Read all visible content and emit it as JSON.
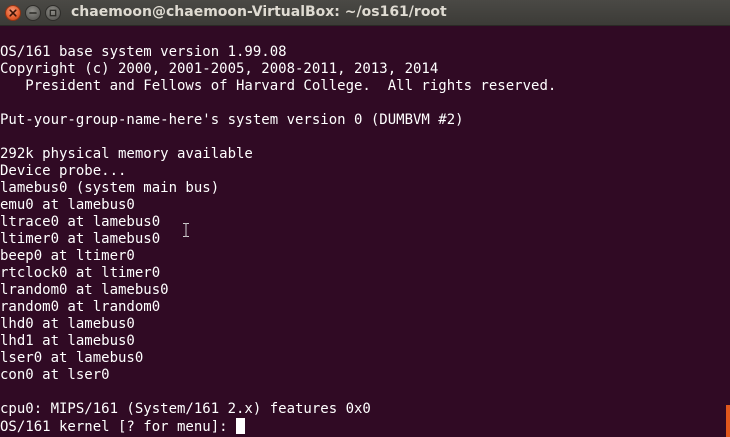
{
  "window": {
    "title": "chaemoon@chaemoon-VirtualBox: ~/os161/root",
    "buttons": [
      {
        "name": "close",
        "icon": "close-icon"
      },
      {
        "name": "minimize",
        "icon": "minimize-icon"
      },
      {
        "name": "maximize",
        "icon": "maximize-icon"
      }
    ]
  },
  "terminal": {
    "lines": [
      "OS/161 base system version 1.99.08",
      "Copyright (c) 2000, 2001-2005, 2008-2011, 2013, 2014",
      "   President and Fellows of Harvard College.  All rights reserved.",
      "",
      "Put-your-group-name-here's system version 0 (DUMBVM #2)",
      "",
      "292k physical memory available",
      "Device probe...",
      "lamebus0 (system main bus)",
      "emu0 at lamebus0",
      "ltrace0 at lamebus0",
      "ltimer0 at lamebus0",
      "beep0 at ltimer0",
      "rtclock0 at ltimer0",
      "lrandom0 at lamebus0",
      "random0 at lrandom0",
      "lhd0 at lamebus0",
      "lhd1 at lamebus0",
      "lser0 at lamebus0",
      "con0 at lser0",
      "",
      "cpu0: MIPS/161 (System/161 2.x) features 0x0"
    ],
    "prompt": "OS/161 kernel [? for menu]: "
  },
  "colors": {
    "background": "#300a24",
    "foreground": "#ffffff",
    "titlebar": "#3c3b37",
    "close_button": "#e25b2b",
    "scroll_marker": "#e0571c"
  }
}
